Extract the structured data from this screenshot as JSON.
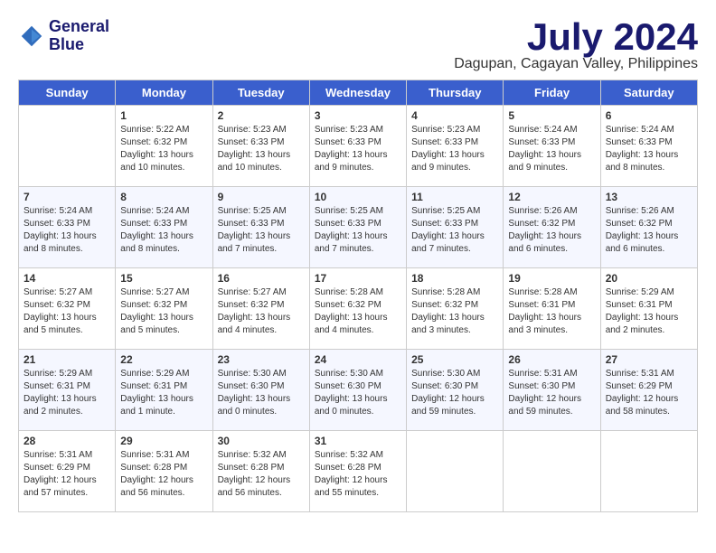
{
  "header": {
    "logo_line1": "General",
    "logo_line2": "Blue",
    "month_title": "July 2024",
    "location": "Dagupan, Cagayan Valley, Philippines"
  },
  "weekdays": [
    "Sunday",
    "Monday",
    "Tuesday",
    "Wednesday",
    "Thursday",
    "Friday",
    "Saturday"
  ],
  "weeks": [
    [
      {
        "day": "",
        "content": ""
      },
      {
        "day": "1",
        "content": "Sunrise: 5:22 AM\nSunset: 6:32 PM\nDaylight: 13 hours\nand 10 minutes."
      },
      {
        "day": "2",
        "content": "Sunrise: 5:23 AM\nSunset: 6:33 PM\nDaylight: 13 hours\nand 10 minutes."
      },
      {
        "day": "3",
        "content": "Sunrise: 5:23 AM\nSunset: 6:33 PM\nDaylight: 13 hours\nand 9 minutes."
      },
      {
        "day": "4",
        "content": "Sunrise: 5:23 AM\nSunset: 6:33 PM\nDaylight: 13 hours\nand 9 minutes."
      },
      {
        "day": "5",
        "content": "Sunrise: 5:24 AM\nSunset: 6:33 PM\nDaylight: 13 hours\nand 9 minutes."
      },
      {
        "day": "6",
        "content": "Sunrise: 5:24 AM\nSunset: 6:33 PM\nDaylight: 13 hours\nand 8 minutes."
      }
    ],
    [
      {
        "day": "7",
        "content": "Sunrise: 5:24 AM\nSunset: 6:33 PM\nDaylight: 13 hours\nand 8 minutes."
      },
      {
        "day": "8",
        "content": "Sunrise: 5:24 AM\nSunset: 6:33 PM\nDaylight: 13 hours\nand 8 minutes."
      },
      {
        "day": "9",
        "content": "Sunrise: 5:25 AM\nSunset: 6:33 PM\nDaylight: 13 hours\nand 7 minutes."
      },
      {
        "day": "10",
        "content": "Sunrise: 5:25 AM\nSunset: 6:33 PM\nDaylight: 13 hours\nand 7 minutes."
      },
      {
        "day": "11",
        "content": "Sunrise: 5:25 AM\nSunset: 6:33 PM\nDaylight: 13 hours\nand 7 minutes."
      },
      {
        "day": "12",
        "content": "Sunrise: 5:26 AM\nSunset: 6:32 PM\nDaylight: 13 hours\nand 6 minutes."
      },
      {
        "day": "13",
        "content": "Sunrise: 5:26 AM\nSunset: 6:32 PM\nDaylight: 13 hours\nand 6 minutes."
      }
    ],
    [
      {
        "day": "14",
        "content": "Sunrise: 5:27 AM\nSunset: 6:32 PM\nDaylight: 13 hours\nand 5 minutes."
      },
      {
        "day": "15",
        "content": "Sunrise: 5:27 AM\nSunset: 6:32 PM\nDaylight: 13 hours\nand 5 minutes."
      },
      {
        "day": "16",
        "content": "Sunrise: 5:27 AM\nSunset: 6:32 PM\nDaylight: 13 hours\nand 4 minutes."
      },
      {
        "day": "17",
        "content": "Sunrise: 5:28 AM\nSunset: 6:32 PM\nDaylight: 13 hours\nand 4 minutes."
      },
      {
        "day": "18",
        "content": "Sunrise: 5:28 AM\nSunset: 6:32 PM\nDaylight: 13 hours\nand 3 minutes."
      },
      {
        "day": "19",
        "content": "Sunrise: 5:28 AM\nSunset: 6:31 PM\nDaylight: 13 hours\nand 3 minutes."
      },
      {
        "day": "20",
        "content": "Sunrise: 5:29 AM\nSunset: 6:31 PM\nDaylight: 13 hours\nand 2 minutes."
      }
    ],
    [
      {
        "day": "21",
        "content": "Sunrise: 5:29 AM\nSunset: 6:31 PM\nDaylight: 13 hours\nand 2 minutes."
      },
      {
        "day": "22",
        "content": "Sunrise: 5:29 AM\nSunset: 6:31 PM\nDaylight: 13 hours\nand 1 minute."
      },
      {
        "day": "23",
        "content": "Sunrise: 5:30 AM\nSunset: 6:30 PM\nDaylight: 13 hours\nand 0 minutes."
      },
      {
        "day": "24",
        "content": "Sunrise: 5:30 AM\nSunset: 6:30 PM\nDaylight: 13 hours\nand 0 minutes."
      },
      {
        "day": "25",
        "content": "Sunrise: 5:30 AM\nSunset: 6:30 PM\nDaylight: 12 hours\nand 59 minutes."
      },
      {
        "day": "26",
        "content": "Sunrise: 5:31 AM\nSunset: 6:30 PM\nDaylight: 12 hours\nand 59 minutes."
      },
      {
        "day": "27",
        "content": "Sunrise: 5:31 AM\nSunset: 6:29 PM\nDaylight: 12 hours\nand 58 minutes."
      }
    ],
    [
      {
        "day": "28",
        "content": "Sunrise: 5:31 AM\nSunset: 6:29 PM\nDaylight: 12 hours\nand 57 minutes."
      },
      {
        "day": "29",
        "content": "Sunrise: 5:31 AM\nSunset: 6:28 PM\nDaylight: 12 hours\nand 56 minutes."
      },
      {
        "day": "30",
        "content": "Sunrise: 5:32 AM\nSunset: 6:28 PM\nDaylight: 12 hours\nand 56 minutes."
      },
      {
        "day": "31",
        "content": "Sunrise: 5:32 AM\nSunset: 6:28 PM\nDaylight: 12 hours\nand 55 minutes."
      },
      {
        "day": "",
        "content": ""
      },
      {
        "day": "",
        "content": ""
      },
      {
        "day": "",
        "content": ""
      }
    ]
  ]
}
